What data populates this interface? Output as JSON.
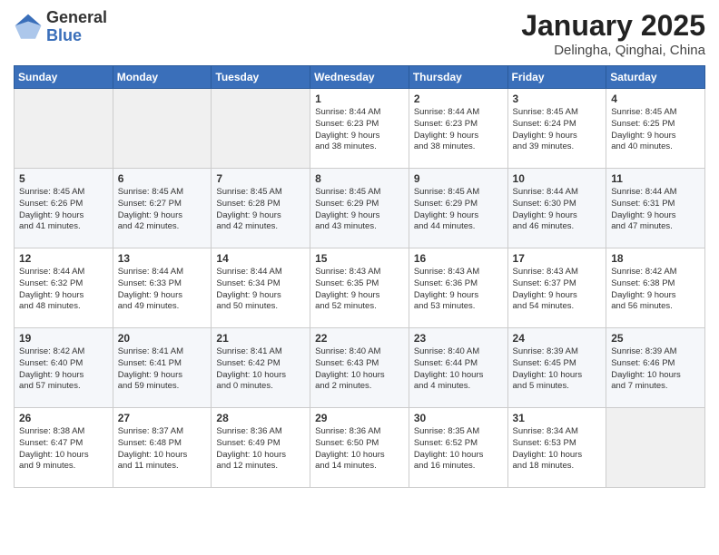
{
  "header": {
    "logo_general": "General",
    "logo_blue": "Blue",
    "month": "January 2025",
    "location": "Delingha, Qinghai, China"
  },
  "weekdays": [
    "Sunday",
    "Monday",
    "Tuesday",
    "Wednesday",
    "Thursday",
    "Friday",
    "Saturday"
  ],
  "weeks": [
    [
      {
        "day": "",
        "info": ""
      },
      {
        "day": "",
        "info": ""
      },
      {
        "day": "",
        "info": ""
      },
      {
        "day": "1",
        "info": "Sunrise: 8:44 AM\nSunset: 6:23 PM\nDaylight: 9 hours\nand 38 minutes."
      },
      {
        "day": "2",
        "info": "Sunrise: 8:44 AM\nSunset: 6:23 PM\nDaylight: 9 hours\nand 38 minutes."
      },
      {
        "day": "3",
        "info": "Sunrise: 8:45 AM\nSunset: 6:24 PM\nDaylight: 9 hours\nand 39 minutes."
      },
      {
        "day": "4",
        "info": "Sunrise: 8:45 AM\nSunset: 6:25 PM\nDaylight: 9 hours\nand 40 minutes."
      }
    ],
    [
      {
        "day": "5",
        "info": "Sunrise: 8:45 AM\nSunset: 6:26 PM\nDaylight: 9 hours\nand 41 minutes."
      },
      {
        "day": "6",
        "info": "Sunrise: 8:45 AM\nSunset: 6:27 PM\nDaylight: 9 hours\nand 42 minutes."
      },
      {
        "day": "7",
        "info": "Sunrise: 8:45 AM\nSunset: 6:28 PM\nDaylight: 9 hours\nand 42 minutes."
      },
      {
        "day": "8",
        "info": "Sunrise: 8:45 AM\nSunset: 6:29 PM\nDaylight: 9 hours\nand 43 minutes."
      },
      {
        "day": "9",
        "info": "Sunrise: 8:45 AM\nSunset: 6:29 PM\nDaylight: 9 hours\nand 44 minutes."
      },
      {
        "day": "10",
        "info": "Sunrise: 8:44 AM\nSunset: 6:30 PM\nDaylight: 9 hours\nand 46 minutes."
      },
      {
        "day": "11",
        "info": "Sunrise: 8:44 AM\nSunset: 6:31 PM\nDaylight: 9 hours\nand 47 minutes."
      }
    ],
    [
      {
        "day": "12",
        "info": "Sunrise: 8:44 AM\nSunset: 6:32 PM\nDaylight: 9 hours\nand 48 minutes."
      },
      {
        "day": "13",
        "info": "Sunrise: 8:44 AM\nSunset: 6:33 PM\nDaylight: 9 hours\nand 49 minutes."
      },
      {
        "day": "14",
        "info": "Sunrise: 8:44 AM\nSunset: 6:34 PM\nDaylight: 9 hours\nand 50 minutes."
      },
      {
        "day": "15",
        "info": "Sunrise: 8:43 AM\nSunset: 6:35 PM\nDaylight: 9 hours\nand 52 minutes."
      },
      {
        "day": "16",
        "info": "Sunrise: 8:43 AM\nSunset: 6:36 PM\nDaylight: 9 hours\nand 53 minutes."
      },
      {
        "day": "17",
        "info": "Sunrise: 8:43 AM\nSunset: 6:37 PM\nDaylight: 9 hours\nand 54 minutes."
      },
      {
        "day": "18",
        "info": "Sunrise: 8:42 AM\nSunset: 6:38 PM\nDaylight: 9 hours\nand 56 minutes."
      }
    ],
    [
      {
        "day": "19",
        "info": "Sunrise: 8:42 AM\nSunset: 6:40 PM\nDaylight: 9 hours\nand 57 minutes."
      },
      {
        "day": "20",
        "info": "Sunrise: 8:41 AM\nSunset: 6:41 PM\nDaylight: 9 hours\nand 59 minutes."
      },
      {
        "day": "21",
        "info": "Sunrise: 8:41 AM\nSunset: 6:42 PM\nDaylight: 10 hours\nand 0 minutes."
      },
      {
        "day": "22",
        "info": "Sunrise: 8:40 AM\nSunset: 6:43 PM\nDaylight: 10 hours\nand 2 minutes."
      },
      {
        "day": "23",
        "info": "Sunrise: 8:40 AM\nSunset: 6:44 PM\nDaylight: 10 hours\nand 4 minutes."
      },
      {
        "day": "24",
        "info": "Sunrise: 8:39 AM\nSunset: 6:45 PM\nDaylight: 10 hours\nand 5 minutes."
      },
      {
        "day": "25",
        "info": "Sunrise: 8:39 AM\nSunset: 6:46 PM\nDaylight: 10 hours\nand 7 minutes."
      }
    ],
    [
      {
        "day": "26",
        "info": "Sunrise: 8:38 AM\nSunset: 6:47 PM\nDaylight: 10 hours\nand 9 minutes."
      },
      {
        "day": "27",
        "info": "Sunrise: 8:37 AM\nSunset: 6:48 PM\nDaylight: 10 hours\nand 11 minutes."
      },
      {
        "day": "28",
        "info": "Sunrise: 8:36 AM\nSunset: 6:49 PM\nDaylight: 10 hours\nand 12 minutes."
      },
      {
        "day": "29",
        "info": "Sunrise: 8:36 AM\nSunset: 6:50 PM\nDaylight: 10 hours\nand 14 minutes."
      },
      {
        "day": "30",
        "info": "Sunrise: 8:35 AM\nSunset: 6:52 PM\nDaylight: 10 hours\nand 16 minutes."
      },
      {
        "day": "31",
        "info": "Sunrise: 8:34 AM\nSunset: 6:53 PM\nDaylight: 10 hours\nand 18 minutes."
      },
      {
        "day": "",
        "info": ""
      }
    ]
  ]
}
